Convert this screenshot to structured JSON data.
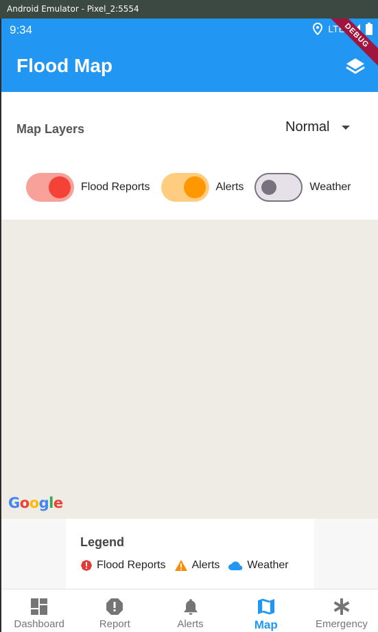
{
  "window": {
    "title": "Android Emulator - Pixel_2:5554"
  },
  "status_bar": {
    "time": "9:34",
    "network": "LTE"
  },
  "app_bar": {
    "title": "Flood Map",
    "debug_banner": "DEBUG"
  },
  "controls": {
    "layers_label": "Map Layers",
    "map_type": "Normal",
    "toggles": [
      {
        "label": "Flood Reports",
        "on": true,
        "color": "#f44336",
        "track": "#f8a09a"
      },
      {
        "label": "Alerts",
        "on": true,
        "color": "#ff9800",
        "track": "#ffcc80"
      },
      {
        "label": "Weather",
        "on": false,
        "color": "#77737e",
        "track": "#e6e0e9"
      }
    ]
  },
  "map": {
    "logo_text": "Google"
  },
  "legend": {
    "title": "Legend",
    "items": [
      {
        "label": "Flood Reports",
        "icon": "error-icon",
        "color": "#e53935"
      },
      {
        "label": "Alerts",
        "icon": "warning-icon",
        "color": "#fb8c00"
      },
      {
        "label": "Weather",
        "icon": "cloud-icon",
        "color": "#2196f3"
      }
    ]
  },
  "bottom_nav": {
    "items": [
      {
        "label": "Dashboard",
        "icon": "dashboard-icon",
        "active": false
      },
      {
        "label": "Report",
        "icon": "report-icon",
        "active": false
      },
      {
        "label": "Alerts",
        "icon": "bell-icon",
        "active": false
      },
      {
        "label": "Map",
        "icon": "map-icon",
        "active": true
      },
      {
        "label": "Emergency",
        "icon": "asterisk-icon",
        "active": false
      }
    ]
  },
  "colors": {
    "primary": "#2196f3",
    "map_background": "#efebe5"
  }
}
